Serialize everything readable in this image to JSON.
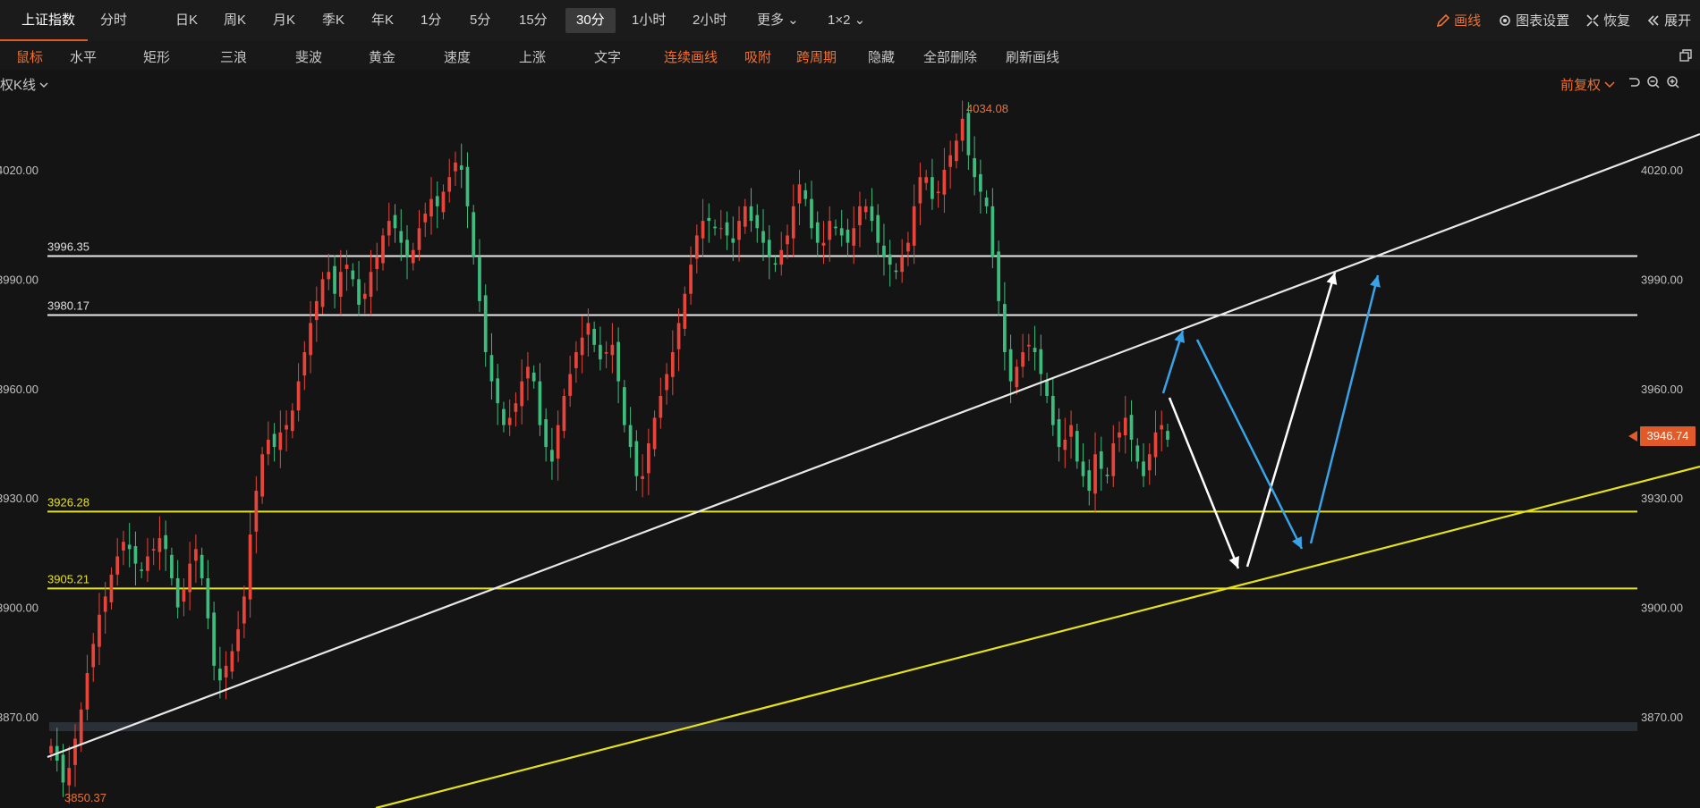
{
  "top_tabs": [
    {
      "label": "上证指数",
      "x": 24
    },
    {
      "label": "分时",
      "x": 112
    },
    {
      "label": "日K",
      "x": 196
    },
    {
      "label": "周K",
      "x": 250
    },
    {
      "label": "月K",
      "x": 305
    },
    {
      "label": "季K",
      "x": 360
    },
    {
      "label": "年K",
      "x": 415
    },
    {
      "label": "1分",
      "x": 470
    },
    {
      "label": "5分",
      "x": 525
    },
    {
      "label": "15分",
      "x": 580
    },
    {
      "label": "30分",
      "x": 632
    },
    {
      "label": "1小时",
      "x": 706
    },
    {
      "label": "2小时",
      "x": 774
    },
    {
      "label": "更多",
      "x": 846
    },
    {
      "label": "1×2",
      "x": 925
    }
  ],
  "right_top": {
    "draw": "画线",
    "settings": "图表设置",
    "restore": "恢复",
    "expand": "展开"
  },
  "toolbar": [
    {
      "label": "鼠标",
      "x": 18
    },
    {
      "label": "水平",
      "x": 78
    },
    {
      "label": "矩形",
      "x": 160
    },
    {
      "label": "三浪",
      "x": 246
    },
    {
      "label": "斐波",
      "x": 330
    },
    {
      "label": "黄金",
      "x": 412
    },
    {
      "label": "速度",
      "x": 496
    },
    {
      "label": "上涨",
      "x": 580
    },
    {
      "label": "文字",
      "x": 664
    },
    {
      "label": "连续画线",
      "x": 742
    },
    {
      "label": "吸附",
      "x": 832
    },
    {
      "label": "跨周期",
      "x": 890
    },
    {
      "label": "隐藏",
      "x": 970
    },
    {
      "label": "全部删除",
      "x": 1032
    },
    {
      "label": "刷新画线",
      "x": 1124
    }
  ],
  "sub": {
    "left_label": "权K线",
    "right_label": "前复权"
  },
  "price_tag": "3946.74",
  "colors": {
    "up": "#e8443a",
    "down": "#3dbd7d",
    "accent": "#e05a2a",
    "yellow": "#e6e21a",
    "white_line": "#e8e8e8",
    "blue_arrow": "#3aa3e8"
  },
  "chart_data": {
    "type": "candlestick",
    "ylim": [
      3845,
      4040
    ],
    "y_ticks": [
      3870,
      3900,
      3930,
      3960,
      3990,
      4020
    ],
    "y_tick_labels": [
      "3870.00",
      "3900.00",
      "3930.00",
      "3960.00",
      "3990.00",
      "4020.00"
    ],
    "high_label": "4034.08",
    "low_label": "3850.37",
    "horizontal_lines": [
      {
        "value": 3996.35,
        "label": "3996.35",
        "color": "white"
      },
      {
        "value": 3980.17,
        "label": "3980.17",
        "color": "white"
      },
      {
        "value": 3926.28,
        "label": "3926.28",
        "color": "yellow"
      },
      {
        "value": 3905.21,
        "label": "3905.21",
        "color": "yellow"
      }
    ],
    "closes": [
      3862,
      3858,
      3852,
      3856,
      3864,
      3872,
      3882,
      3890,
      3898,
      3903,
      3909,
      3914,
      3918,
      3916,
      3912,
      3910,
      3914,
      3916,
      3919,
      3916,
      3908,
      3900,
      3905,
      3912,
      3916,
      3908,
      3897,
      3884,
      3880,
      3884,
      3888,
      3894,
      3903,
      3920,
      3932,
      3942,
      3946,
      3944,
      3948,
      3950,
      3954,
      3962,
      3970,
      3978,
      3984,
      3990,
      3992,
      3986,
      3992,
      3994,
      3990,
      3983,
      3986,
      3992,
      3996,
      4002,
      4006,
      4004,
      4000,
      3996,
      3998,
      4004,
      4008,
      4012,
      4010,
      4014,
      4018,
      4022,
      4020,
      4010,
      3996,
      3984,
      3970,
      3962,
      3956,
      3950,
      3952,
      3956,
      3962,
      3966,
      3962,
      3950,
      3944,
      3940,
      3950,
      3958,
      3964,
      3970,
      3974,
      3978,
      3972,
      3968,
      3970,
      3972,
      3962,
      3950,
      3944,
      3936,
      3936,
      3945,
      3952,
      3958,
      3964,
      3970,
      3978,
      3986,
      3994,
      4002,
      4006,
      4006,
      4004,
      4004,
      4002,
      4000,
      4006,
      4010,
      4006,
      4004,
      4000,
      3996,
      3994,
      3998,
      4002,
      4010,
      4016,
      4012,
      4004,
      4000,
      4000,
      4006,
      4004,
      4002,
      4000,
      4004,
      4010,
      4010,
      4006,
      4000,
      3996,
      3994,
      3992,
      3996,
      4000,
      4010,
      4018,
      4018,
      4012,
      4014,
      4020,
      4024,
      4028,
      4034,
      4024,
      4018,
      4014,
      4010,
      3996,
      3984,
      3970,
      3962,
      3966,
      3970,
      3972,
      3970,
      3964,
      3958,
      3950,
      3944,
      3946,
      3950,
      3940,
      3936,
      3932,
      3942,
      3938,
      3936,
      3945,
      3948,
      3952,
      3946,
      3940,
      3936,
      3942,
      3948,
      3950,
      3946
    ]
  }
}
